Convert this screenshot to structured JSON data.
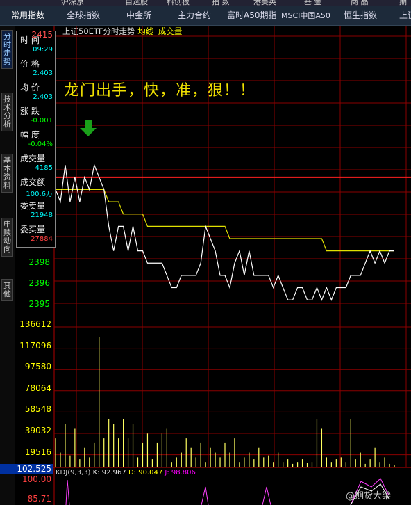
{
  "topbar": {
    "items": [
      "沪深京",
      "自选股",
      "科创板",
      "指 数",
      "港美英",
      "基 金",
      "商 品",
      "期"
    ]
  },
  "tabs": [
    "常用指数",
    "全球指数",
    "中金所",
    "主力合约",
    "富时A50期指",
    "MSCI中国A50",
    "恒生指数",
    "上证"
  ],
  "sidetabs": [
    "分时走势",
    "技术分析",
    "基本资料",
    "申赎动向",
    "其他"
  ],
  "title": {
    "name": "上证50ETF分时走势",
    "avg": "均线",
    "vol": "成交量"
  },
  "info": [
    {
      "label": "时 间",
      "value": "09:29",
      "color": "#00ffff"
    },
    {
      "label": "价 格",
      "value": "2.403",
      "color": "#00ffff"
    },
    {
      "label": "均 价",
      "value": "2.403",
      "color": "#00ffff"
    },
    {
      "label": "涨 跌",
      "value": "-0.001",
      "color": "#00ff00"
    },
    {
      "label": "幅 度",
      "value": "-0.04%",
      "color": "#00ff00"
    },
    {
      "label": "成交量",
      "value": "4185",
      "color": "#00ffff"
    },
    {
      "label": "成交额",
      "value": "100.6万",
      "color": "#00ffff"
    },
    {
      "label": "委卖量",
      "value": "21948",
      "color": "#00ffff"
    },
    {
      "label": "委买量",
      "value": "27884",
      "color": "#ff4040"
    }
  ],
  "price_axis": {
    "top": "2415",
    "labels": [
      "2398",
      "2396",
      "2395"
    ]
  },
  "volume_axis": [
    "136612",
    "117096",
    "97580",
    "78064",
    "58548",
    "39032",
    "19516"
  ],
  "bottom_value": "102.525",
  "kdj_axis": [
    "100.00",
    "85.71"
  ],
  "headline": "龙门出手，快，准，狠！！",
  "kdj": {
    "name": "KDJ(9,3,3)",
    "k": "K: 92.967",
    "d": "D: 90.047",
    "j": "J: 98.806"
  },
  "watermark": "@期货大梁",
  "chart_data": {
    "type": "line",
    "title": "上证50ETF分时走势",
    "price": [
      2.403,
      2.402,
      2.405,
      2.402,
      2.404,
      2.402,
      2.404,
      2.403,
      2.405,
      2.404,
      2.403,
      2.4,
      2.398,
      2.4,
      2.4,
      2.398,
      2.4,
      2.398,
      2.398,
      2.397,
      2.397,
      2.397,
      2.397,
      2.396,
      2.395,
      2.395,
      2.396,
      2.396,
      2.396,
      2.396,
      2.397,
      2.4,
      2.399,
      2.398,
      2.396,
      2.396,
      2.395,
      2.397,
      2.398,
      2.396,
      2.398,
      2.396,
      2.396,
      2.396,
      2.396,
      2.395,
      2.396,
      2.395,
      2.394,
      2.394,
      2.395,
      2.395,
      2.394,
      2.394,
      2.395,
      2.394,
      2.395,
      2.394,
      2.395,
      2.395,
      2.395,
      2.396,
      2.396,
      2.396,
      2.397,
      2.398,
      2.397,
      2.398,
      2.397,
      2.398,
      2.398
    ],
    "avg": [
      2.403,
      2.403,
      2.403,
      2.403,
      2.403,
      2.403,
      2.403,
      2.403,
      2.403,
      2.403,
      2.403,
      2.402,
      2.402,
      2.402,
      2.401,
      2.401,
      2.401,
      2.401,
      2.401,
      2.4,
      2.4,
      2.4,
      2.4,
      2.4,
      2.4,
      2.4,
      2.4,
      2.4,
      2.4,
      2.4,
      2.4,
      2.4,
      2.4,
      2.4,
      2.4,
      2.4,
      2.399,
      2.399,
      2.399,
      2.399,
      2.399,
      2.399,
      2.399,
      2.399,
      2.399,
      2.399,
      2.399,
      2.399,
      2.399,
      2.399,
      2.399,
      2.399,
      2.399,
      2.399,
      2.399,
      2.399,
      2.398,
      2.398,
      2.398,
      2.398,
      2.398,
      2.398,
      2.398,
      2.398,
      2.398,
      2.398,
      2.398,
      2.398,
      2.398,
      2.398,
      2.398
    ],
    "ylim": [
      2.3935,
      2.4155
    ],
    "reference_price": 2.404,
    "volume": [
      30000,
      15000,
      45000,
      12000,
      40000,
      8000,
      20000,
      10000,
      25000,
      136612,
      30000,
      50000,
      45000,
      30000,
      50000,
      30000,
      45000,
      10000,
      25000,
      35000,
      8000,
      25000,
      35000,
      40000,
      5000,
      10000,
      15000,
      30000,
      20000,
      10000,
      25000,
      5000,
      20000,
      15000,
      10000,
      25000,
      15000,
      30000,
      5000,
      10000,
      15000,
      8000,
      20000,
      10000,
      12000,
      5000,
      15000,
      5000,
      8000,
      3000,
      5000,
      8000,
      4000,
      5000,
      50000,
      40000,
      10000,
      5000,
      8000,
      10000,
      5000,
      50000,
      8000,
      15000,
      3000,
      8000,
      20000,
      5000,
      10000,
      3000,
      2000
    ],
    "volume_ylim": [
      0,
      146000
    ]
  }
}
